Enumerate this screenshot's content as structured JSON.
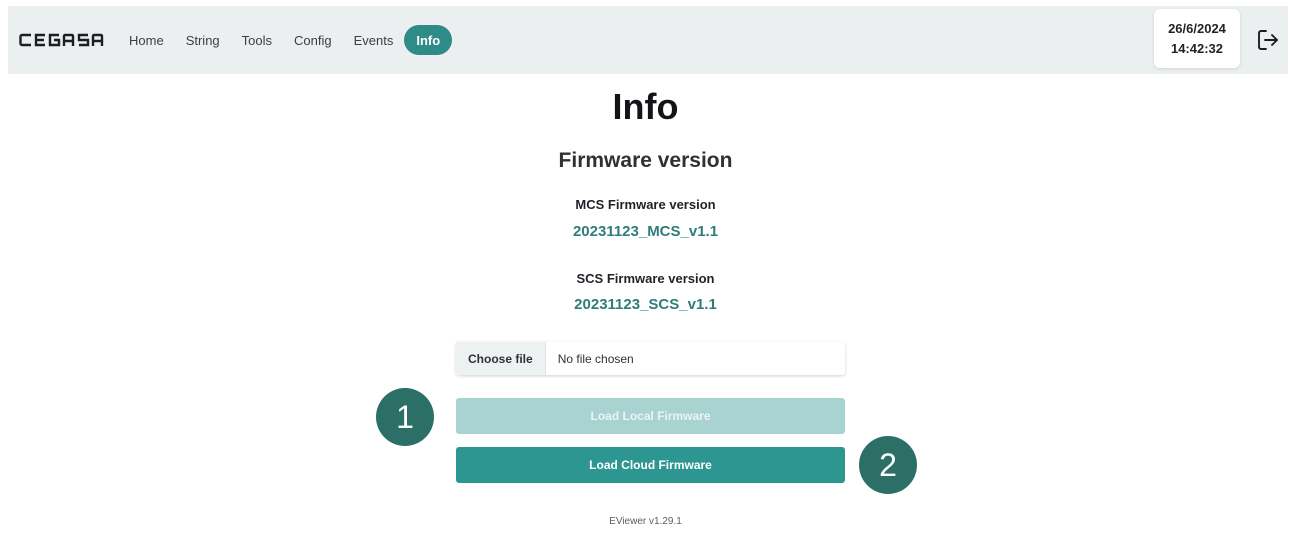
{
  "brand": {
    "logo_text": "CEGASA"
  },
  "nav": {
    "items": [
      {
        "label": "Home"
      },
      {
        "label": "String"
      },
      {
        "label": "Tools"
      },
      {
        "label": "Config"
      },
      {
        "label": "Events"
      },
      {
        "label": "Info",
        "active": true
      }
    ]
  },
  "header": {
    "date": "26/6/2024",
    "time": "14:42:32",
    "logout_icon": "logout-icon"
  },
  "page": {
    "title": "Info",
    "section_title": "Firmware version",
    "mcs": {
      "label": "MCS Firmware version",
      "value": "20231123_MCS_v1.1"
    },
    "scs": {
      "label": "SCS Firmware version",
      "value": "20231123_SCS_v1.1"
    }
  },
  "file_input": {
    "button_label": "Choose file",
    "status": "No file chosen"
  },
  "actions": {
    "load_local": "Load Local Firmware",
    "load_cloud": "Load Cloud Firmware"
  },
  "markers": {
    "one": "1",
    "two": "2"
  },
  "footer": {
    "version": "EViewer v1.29.1"
  },
  "colors": {
    "accent": "#2e8b87",
    "accent_disabled": "#a9d3d1",
    "marker": "#2b6f66",
    "version_text": "#2e7d78"
  }
}
